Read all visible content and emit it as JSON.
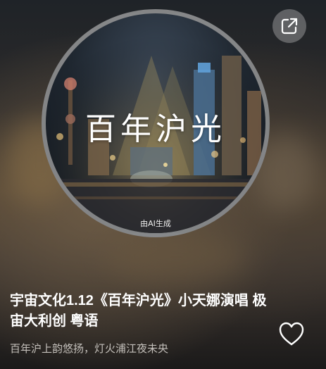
{
  "cover": {
    "title": "百年沪光",
    "ai_label": "由AI生成"
  },
  "title": "宇宙文化1.12《百年沪光》小天娜演唱 极宙大利创 粤语",
  "subtitle": "百年沪上韵悠扬，灯火浦江夜未央",
  "icons": {
    "share": "share-icon",
    "like": "heart-icon"
  },
  "colors": {
    "title_text": "#ffffff",
    "subtitle_text": "#c4c0bb",
    "cover_border": "#969696"
  }
}
